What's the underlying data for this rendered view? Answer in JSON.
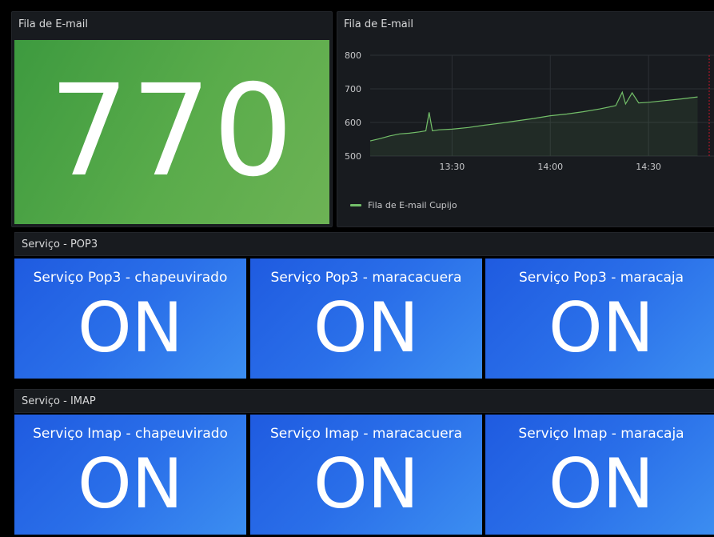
{
  "colors": {
    "background": "#000000",
    "panel": "#181b1f",
    "stat_green": "#5aac4b",
    "stat_blue": "#2a6fe9",
    "series_green": "#73bf69",
    "threshold_red": "#c4162a"
  },
  "top_row": {
    "stat_panel": {
      "title": "Fila de E-mail",
      "value": "770"
    },
    "graph_panel": {
      "title": "Fila de E-mail",
      "legend": "Fila de E-mail Cupijo"
    }
  },
  "rows": [
    {
      "title": "Serviço - POP3",
      "tiles": [
        {
          "title": "Serviço Pop3 - chapeuvirado",
          "value": "ON"
        },
        {
          "title": "Serviço Pop3 - maracacuera",
          "value": "ON"
        },
        {
          "title": "Serviço Pop3 - maracaja",
          "value": "ON"
        }
      ]
    },
    {
      "title": "Serviço - IMAP",
      "tiles": [
        {
          "title": "Serviço Imap - chapeuvirado",
          "value": "ON"
        },
        {
          "title": "Serviço Imap - maracacuera",
          "value": "ON"
        },
        {
          "title": "Serviço Imap - maracaja",
          "value": "ON"
        }
      ]
    }
  ],
  "chart_data": {
    "type": "area",
    "title": "Fila de E-mail",
    "xlabel": "",
    "ylabel": "",
    "x_ticks": [
      "13:30",
      "14:00",
      "14:30"
    ],
    "y_ticks": [
      500,
      600,
      700,
      800
    ],
    "ylim": [
      500,
      800
    ],
    "grid": true,
    "legend_placement": "bottom-left",
    "series": [
      {
        "name": "Fila de E-mail Cupijo",
        "color": "#73bf69",
        "x": [
          "13:05",
          "13:08",
          "13:11",
          "13:14",
          "13:17",
          "13:20",
          "13:22",
          "13:23",
          "13:24",
          "13:26",
          "13:30",
          "13:35",
          "13:40",
          "13:45",
          "13:50",
          "13:55",
          "14:00",
          "14:05",
          "14:10",
          "14:15",
          "14:20",
          "14:22",
          "14:23",
          "14:25",
          "14:27",
          "14:30",
          "14:35",
          "14:40",
          "14:45"
        ],
        "values": [
          545,
          552,
          560,
          566,
          568,
          572,
          575,
          630,
          575,
          578,
          580,
          585,
          592,
          598,
          605,
          612,
          620,
          625,
          632,
          640,
          650,
          690,
          655,
          688,
          658,
          660,
          665,
          670,
          676
        ]
      }
    ],
    "annotations": []
  }
}
